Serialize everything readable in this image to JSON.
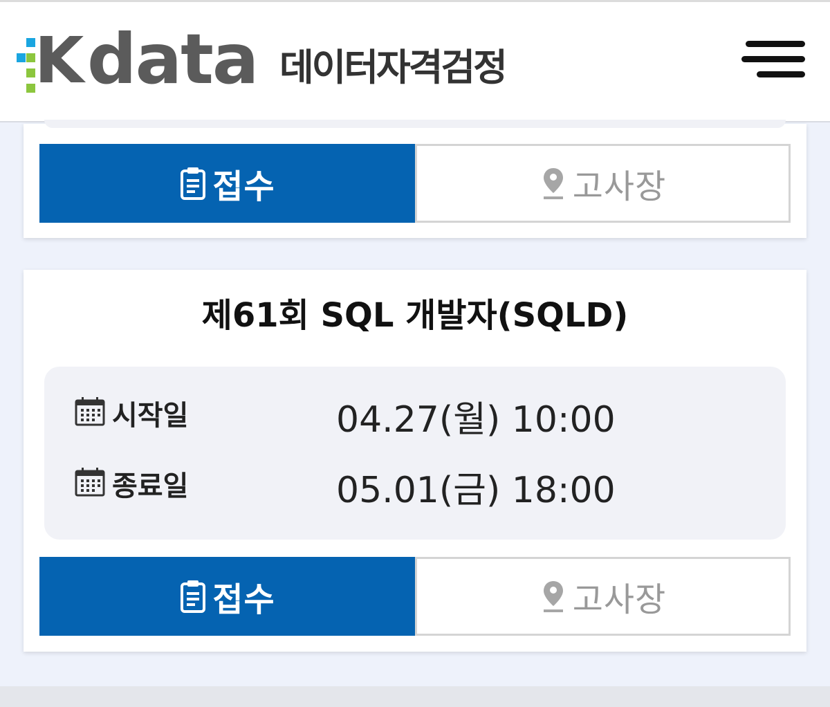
{
  "header": {
    "logo_k": "K",
    "logo_data": "data",
    "logo_korean": "데이터자격검정",
    "menu_icon": "hamburger-menu-icon"
  },
  "colors": {
    "primary_blue": "#0563b1",
    "logo_gray": "#5b5b5b",
    "logo_dot_blue": "#1aa5e0",
    "logo_dot_green": "#8cc63e",
    "page_bg": "#eef2fb"
  },
  "card_top": {
    "apply_label": "접수",
    "apply_icon": "clipboard-icon",
    "site_label": "고사장",
    "site_icon": "map-pin-icon"
  },
  "card_exam": {
    "title": "제61회 SQL 개발자(SQLD)",
    "start_label": "시작일",
    "start_value": "04.27(월) 10:00",
    "end_label": "종료일",
    "end_value": "05.01(금) 18:00",
    "calendar_icon": "calendar-icon",
    "apply_label": "접수",
    "site_label": "고사장"
  }
}
